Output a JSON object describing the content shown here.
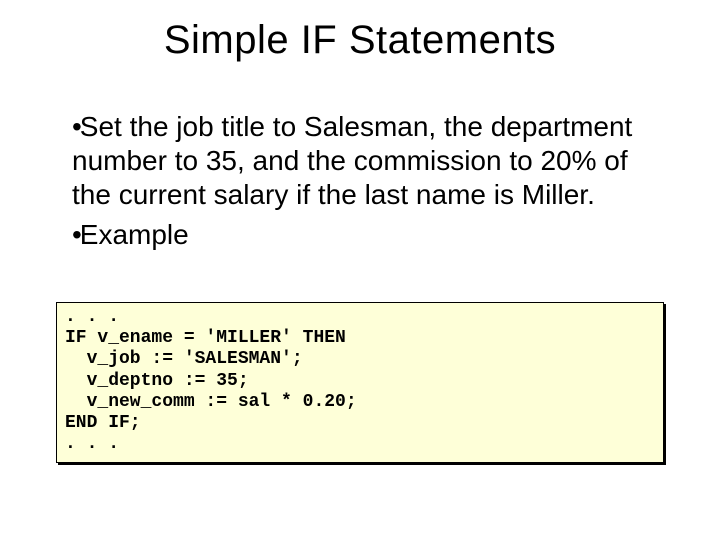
{
  "title": "Simple IF Statements",
  "bullets": [
    {
      "mark": "•",
      "text": "Set the job title to Salesman, the department number to 35, and the commission to 20% of the current salary if the last name is Miller."
    },
    {
      "mark": "•",
      "text": "Example"
    }
  ],
  "code": ". . .\nIF v_ename = 'MILLER' THEN\n  v_job := 'SALESMAN';\n  v_deptno := 35;\n  v_new_comm := sal * 0.20;\nEND IF;\n. . ."
}
